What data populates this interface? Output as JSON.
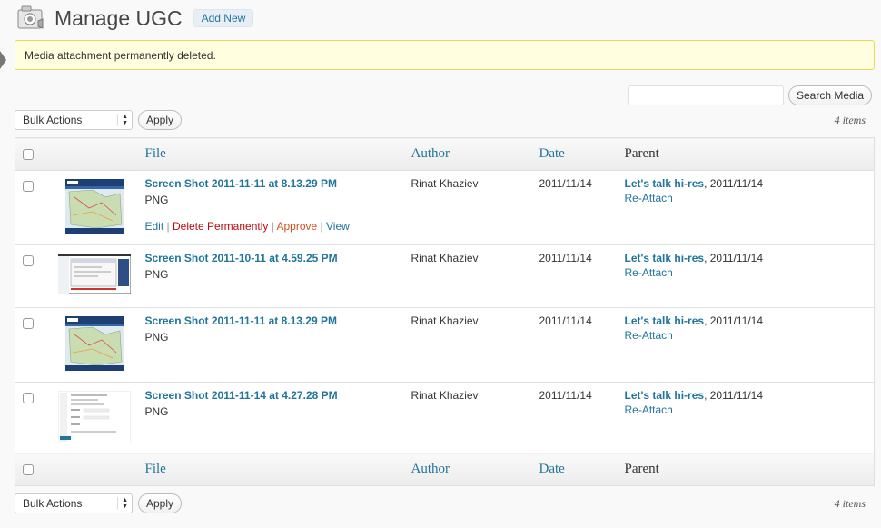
{
  "header": {
    "title": "Manage UGC",
    "add_new_label": "Add New"
  },
  "notice": {
    "message": "Media attachment permanently deleted."
  },
  "search": {
    "button_label": "Search Media",
    "value": ""
  },
  "tablenav_top": {
    "bulk_actions": "Bulk Actions",
    "apply_label": "Apply",
    "items_count": "4 items"
  },
  "tablenav_bottom": {
    "bulk_actions": "Bulk Actions",
    "apply_label": "Apply",
    "items_count": "4 items"
  },
  "columns": {
    "file": "File",
    "author": "Author",
    "date": "Date",
    "parent": "Parent"
  },
  "rows": [
    {
      "filename": "Screen Shot 2011-11-11 at 8.13.29 PM",
      "type": "PNG",
      "author": "Rinat Khaziev",
      "date": "2011/11/14",
      "parent_title": "Let's talk hi-res",
      "parent_date": ", 2011/11/14",
      "reattach": "Re-Attach",
      "thumb": "map"
    },
    {
      "filename": "Screen Shot 2011-10-11 at 4.59.25 PM",
      "type": "PNG",
      "author": "Rinat Khaziev",
      "date": "2011/11/14",
      "parent_title": "Let's talk hi-res",
      "parent_date": ", 2011/11/14",
      "reattach": "Re-Attach",
      "thumb": "desktop"
    },
    {
      "filename": "Screen Shot 2011-11-11 at 8.13.29 PM",
      "type": "PNG",
      "author": "Rinat Khaziev",
      "date": "2011/11/14",
      "parent_title": "Let's talk hi-res",
      "parent_date": ", 2011/11/14",
      "reattach": "Re-Attach",
      "thumb": "map"
    },
    {
      "filename": "Screen Shot 2011-11-14 at 4.27.28 PM",
      "type": "PNG",
      "author": "Rinat Khaziev",
      "date": "2011/11/14",
      "parent_title": "Let's talk hi-res",
      "parent_date": ", 2011/11/14",
      "reattach": "Re-Attach",
      "thumb": "form"
    }
  ],
  "row_actions": {
    "edit": "Edit",
    "delete": "Delete Permanently",
    "approve": "Approve",
    "view": "View",
    "separator": " | "
  },
  "colors": {
    "link": "#21759b",
    "delete": "#bc0b0b",
    "approve": "#d54e21",
    "notice_bg": "#ffffe0",
    "notice_border": "#e6db55"
  }
}
